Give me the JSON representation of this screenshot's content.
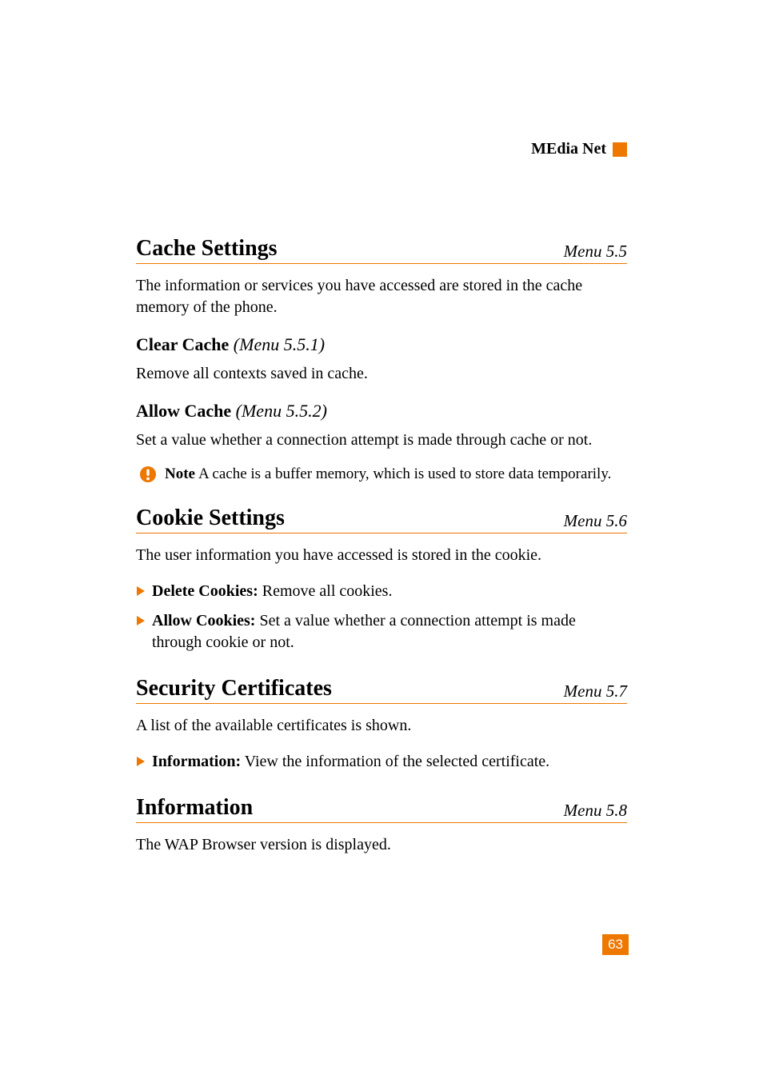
{
  "header": {
    "label": "MEdia Net"
  },
  "page_number": "63",
  "sections": [
    {
      "title": "Cache Settings",
      "menu_ref": "Menu 5.5",
      "intro": "The information or services you have accessed are stored in the cache memory of the phone.",
      "subsections": [
        {
          "title": "Clear Cache",
          "ref": "(Menu 5.5.1)",
          "body": "Remove all contexts saved in cache."
        },
        {
          "title": "Allow Cache",
          "ref": "(Menu 5.5.2)",
          "body": "Set a value whether a connection attempt is made through cache or not."
        }
      ],
      "note": {
        "label": "Note",
        "text": "A cache is a buffer memory, which is used to store data temporarily."
      }
    },
    {
      "title": "Cookie Settings",
      "menu_ref": "Menu 5.6",
      "intro": "The user information you have accessed is stored in the cookie.",
      "bullets": [
        {
          "label": "Delete Cookies:",
          "text": " Remove all cookies."
        },
        {
          "label": "Allow Cookies:",
          "text": " Set a value whether a connection attempt is made through cookie or not."
        }
      ]
    },
    {
      "title": "Security Certificates",
      "menu_ref": "Menu 5.7",
      "intro": "A list of the available certificates is shown.",
      "bullets": [
        {
          "label": "Information:",
          "text": " View the information of the selected certificate."
        }
      ]
    },
    {
      "title": "Information",
      "menu_ref": "Menu 5.8",
      "intro": "The WAP Browser version is displayed."
    }
  ]
}
